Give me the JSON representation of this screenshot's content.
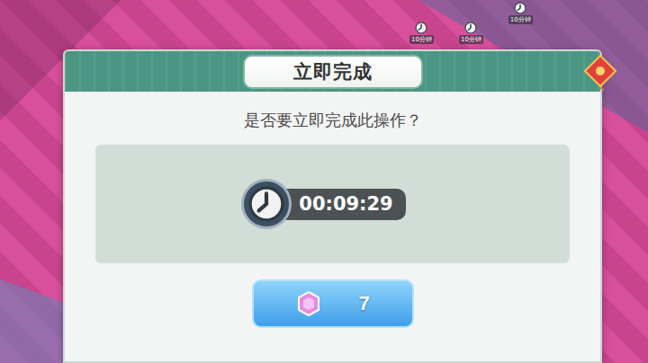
{
  "background": {
    "tile_timers": [
      {
        "label": "10分钟"
      },
      {
        "label": "10分钟"
      },
      {
        "label": "10分钟"
      }
    ]
  },
  "dialog": {
    "title": "立即完成",
    "message": "是否要立即完成此操作？",
    "timer": "00:09:29",
    "confirm_button": {
      "cost": "7"
    }
  }
}
